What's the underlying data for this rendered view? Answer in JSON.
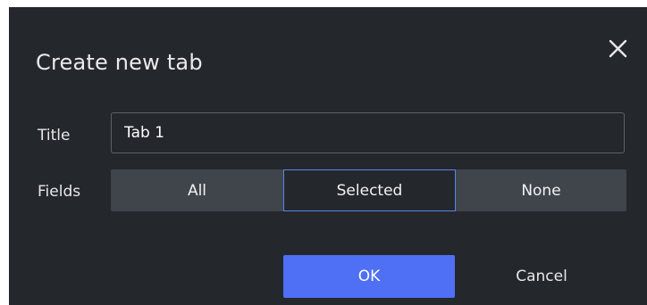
{
  "dialog": {
    "title": "Create new tab",
    "close_icon": "close-icon",
    "title_label": "Title",
    "title_value": "Tab 1",
    "fields_label": "Fields",
    "fields_options": [
      "All",
      "Selected",
      "None"
    ],
    "fields_selected": "Selected",
    "ok_label": "OK",
    "cancel_label": "Cancel"
  },
  "colors": {
    "background": "#24272b",
    "accent": "#4f6ff4",
    "segment_bg": "#40454b",
    "selected_border": "#5b82ee"
  }
}
